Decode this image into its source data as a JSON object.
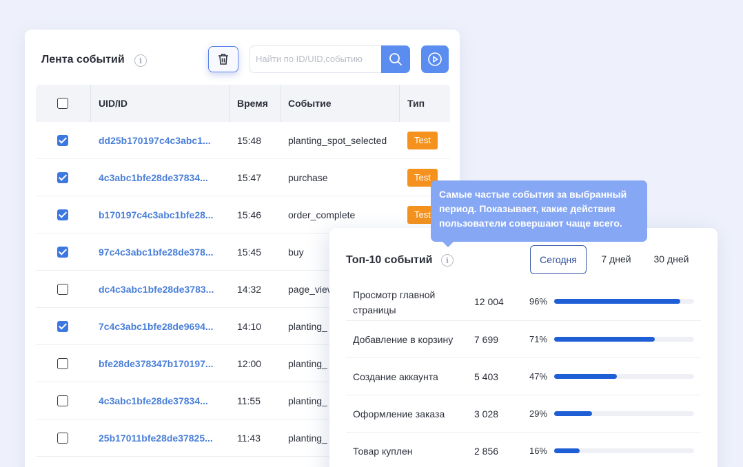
{
  "feed": {
    "title": "Лента событий",
    "search_placeholder": "Найти по ID/UID,событию",
    "columns": [
      "UID/ID",
      "Время",
      "Событие",
      "Тип"
    ],
    "rows": [
      {
        "uid": "dd25b170197c4c3abc1...",
        "time": "15:48",
        "event": "planting_spot_selected",
        "type": "Test",
        "checked": true
      },
      {
        "uid": "4c3abc1bfe28de37834...",
        "time": "15:47",
        "event": "purchase",
        "type": "Test",
        "checked": true
      },
      {
        "uid": "b170197c4c3abc1bfe28...",
        "time": "15:46",
        "event": "order_complete",
        "type": "Test",
        "checked": true
      },
      {
        "uid": "97c4c3abc1bfe28de378...",
        "time": "15:45",
        "event": "buy",
        "type": "",
        "checked": true
      },
      {
        "uid": "dc4c3abc1bfe28de3783...",
        "time": "14:32",
        "event": "page_view",
        "type": "",
        "checked": false
      },
      {
        "uid": "7c4c3abc1bfe28de9694...",
        "time": "14:10",
        "event": "planting_",
        "type": "",
        "checked": true
      },
      {
        "uid": "bfe28de378347b170197...",
        "time": "12:00",
        "event": "planting_",
        "type": "",
        "checked": false
      },
      {
        "uid": "4c3abc1bfe28de37834...",
        "time": "11:55",
        "event": "planting_",
        "type": "",
        "checked": false
      },
      {
        "uid": "25b17011bfe28de37825...",
        "time": "11:43",
        "event": "planting_",
        "type": "",
        "checked": false
      }
    ]
  },
  "tooltip": {
    "text": "Самые частые события за выбранный период. Показывает, какие действия пользователи совершают чаще всего."
  },
  "top": {
    "title": "Топ-10 событий",
    "periods": [
      {
        "label": "Сегодня",
        "active": true
      },
      {
        "label": "7 дней",
        "active": false
      },
      {
        "label": "30 дней",
        "active": false
      }
    ],
    "items": [
      {
        "name": "Просмотр главной страницы",
        "count": "12 004",
        "pct": "96%",
        "value": 0.9
      },
      {
        "name": "Добавление в корзину",
        "count": "7 699",
        "pct": "71%",
        "value": 0.72
      },
      {
        "name": "Создание аккаунта",
        "count": "5 403",
        "pct": "47%",
        "value": 0.45
      },
      {
        "name": "Оформление заказа",
        "count": "3 028",
        "pct": "29%",
        "value": 0.27
      },
      {
        "name": "Товар куплен",
        "count": "2 856",
        "pct": "16%",
        "value": 0.18
      }
    ]
  },
  "icons": {
    "info": "info-icon",
    "trash": "trash-icon",
    "search": "search-icon",
    "play": "play-icon"
  },
  "colors": {
    "accent": "#5b8cf0",
    "badge": "#f5921e",
    "bar": "#1f5fd6",
    "tooltip": "#86a8f4"
  }
}
